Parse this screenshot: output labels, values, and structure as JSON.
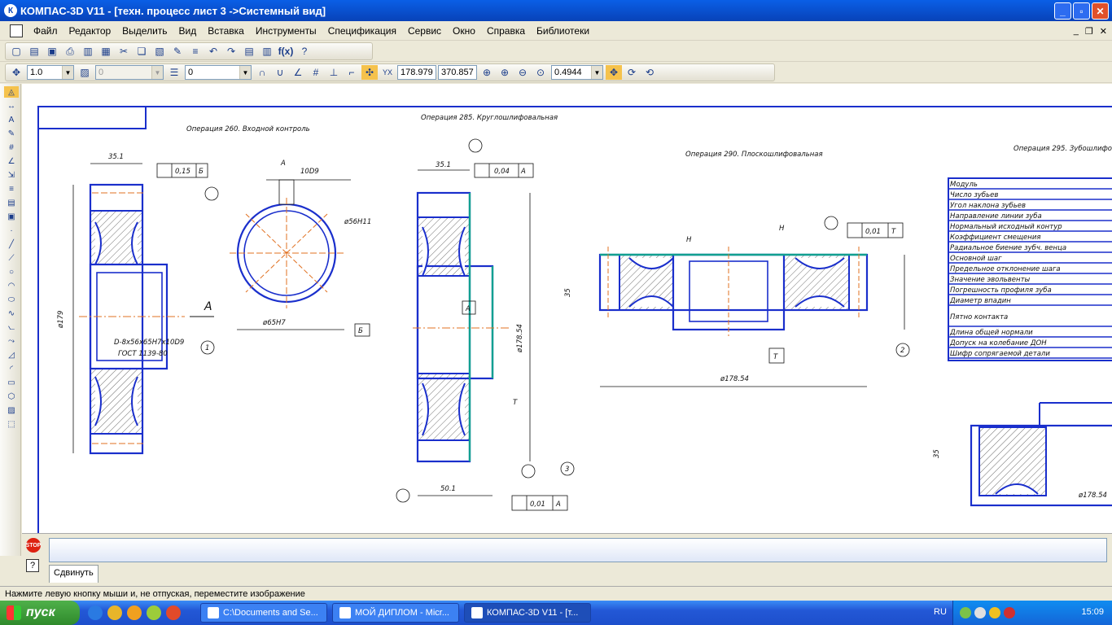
{
  "window": {
    "title": "КОМПАС-3D V11 - [техн. процесс лист 3 ->Системный вид]",
    "app_icon": "К"
  },
  "menu": [
    "Файл",
    "Редактор",
    "Выделить",
    "Вид",
    "Вставка",
    "Инструменты",
    "Спецификация",
    "Сервис",
    "Окно",
    "Справка",
    "Библиотеки"
  ],
  "toolbar2": {
    "scale": "1.0",
    "style": "0",
    "layer": "0",
    "x": "178.979",
    "y": "370.857",
    "zoom": "0.4944",
    "fx": "f(x)"
  },
  "drawing": {
    "op260": "Операция 260. Входной контроль",
    "op285": "Операция 285. Круглошлифовальная",
    "op290": "Операция 290. Плоскошлифовальная",
    "op295": "Операция 295. Зубошлифо",
    "dim_351a": "35.1",
    "dim_351b": "35.1",
    "tol_015": "0,15",
    "tol_006": "0,04",
    "tol_001a": "0,01",
    "tol_001b": "0,01",
    "base_b": "Б",
    "base_a": "А",
    "base_t": "Т",
    "dim_179": "ø179",
    "spline": "D-8x56x65H7x10D9",
    "gost": "ГОСТ 1139-80",
    "dim_1009": "10D9",
    "dim_56": "ø56H11",
    "dim_65": "ø65H7",
    "dim_17854": "ø178.54",
    "dim_501": "50.1",
    "dim_35": "35",
    "label_h": "Н",
    "label_n": "Н",
    "view_a": "А",
    "circle_1": "1",
    "circle_2": "2",
    "circle_3": "3",
    "table_rows": [
      "Модуль",
      "Число зубьев",
      "Угол наклона зубьев",
      "Направление линии зуба",
      "Нормальный исходный контур",
      "Коэффициент смещения",
      "Радиальное биение зубч. венца",
      "Основной шаг",
      "Предельное отклонение шага",
      "Значение эвольвенты",
      "Погрешность профиля зуба",
      "Диаметр впадин",
      "Пятно контакта",
      "Длина общей нормали",
      "Допуск на колебание ДОН",
      "Шифр сопрягаемой детали"
    ]
  },
  "props": {
    "tab": "Сдвинуть",
    "stop": "STOP",
    "help": "?"
  },
  "status": "Нажмите левую кнопку мыши и, не отпуская, переместите изображение",
  "taskbar": {
    "start": "пуск",
    "tasks": [
      "C:\\Documents and Se...",
      "МОЙ ДИПЛОМ - Micr...",
      "КОМПАС-3D V11 - [т..."
    ],
    "lang": "RU",
    "clock": "15:09"
  }
}
